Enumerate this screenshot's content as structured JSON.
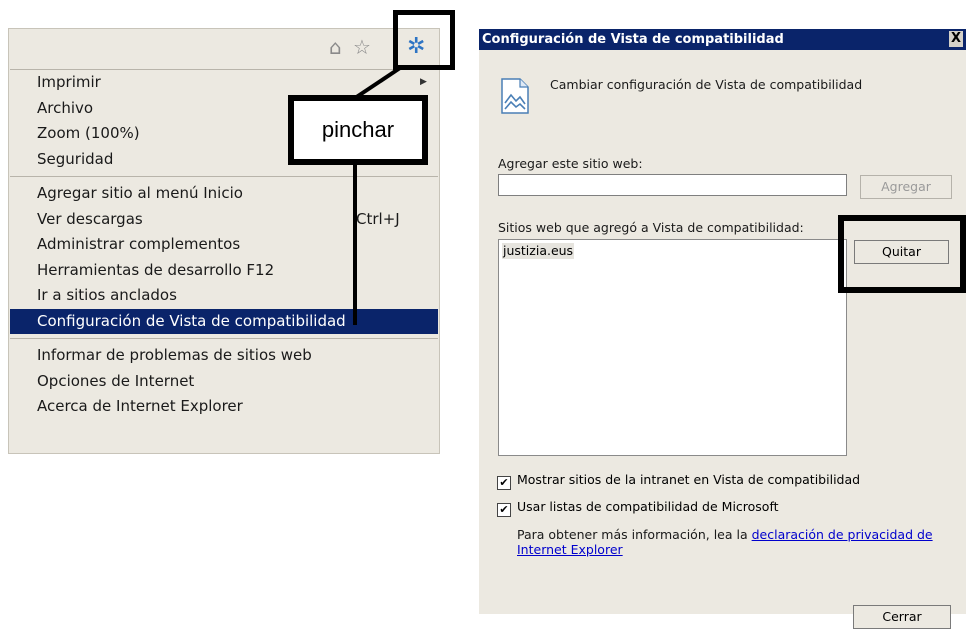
{
  "menu": {
    "items_group1": [
      {
        "label": "Imprimir",
        "has_submenu": true
      },
      {
        "label": "Archivo",
        "has_submenu": true
      },
      {
        "label": "Zoom (100%)",
        "has_submenu": true
      },
      {
        "label": "Seguridad",
        "has_submenu": true
      }
    ],
    "items_group2": [
      {
        "label": "Agregar sitio al menú Inicio"
      },
      {
        "label": "Ver descargas",
        "shortcut": "Ctrl+J"
      },
      {
        "label": "Administrar complementos"
      },
      {
        "label": "Herramientas de desarrollo F12"
      },
      {
        "label": "Ir a sitios anclados"
      },
      {
        "label": "Configuración de Vista de compatibilidad",
        "selected": true
      }
    ],
    "items_group3": [
      {
        "label": "Informar de problemas de sitios web"
      },
      {
        "label": "Opciones de Internet"
      },
      {
        "label": "Acerca de Internet Explorer"
      }
    ],
    "icons": [
      "home-icon",
      "star-icon",
      "gear-icon"
    ]
  },
  "annotation": {
    "label": "pinchar"
  },
  "dialog": {
    "title": "Configuración de Vista de compatibilidad",
    "close_glyph": "X",
    "heading": "Cambiar configuración de Vista de compatibilidad",
    "add_site_label": "Agregar este sitio web:",
    "add_site_value": "",
    "add_button": "Agregar",
    "sites_label": "Sitios web que agregó a Vista de compatibilidad:",
    "sites": [
      "justizia.eus"
    ],
    "remove_button": "Quitar",
    "checkbox_intranet": {
      "label": "Mostrar sitios de la intranet en Vista de compatibilidad",
      "checked": true
    },
    "checkbox_ms_lists": {
      "label": "Usar listas de compatibilidad de Microsoft",
      "checked": true
    },
    "info_text": "Para obtener más información, lea la ",
    "privacy_link": "declaración de privacidad de Internet Explorer",
    "close_button": "Cerrar"
  },
  "colors": {
    "menu_bg": "#ece9e1",
    "selected_bg": "#0a246a",
    "titlebar_bg": "#0a246a",
    "link": "#0000cc",
    "gear": "#2d74c4"
  }
}
